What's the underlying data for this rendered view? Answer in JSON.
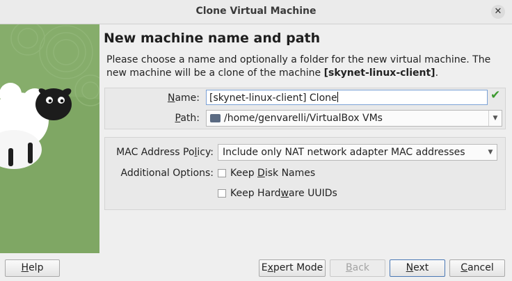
{
  "window": {
    "title": "Clone Virtual Machine",
    "close_glyph": "✕"
  },
  "page": {
    "heading": "New machine name and path",
    "description_prefix": "Please choose a name and optionally a folder for the new virtual machine. The new machine will be a clone of the machine ",
    "source_machine": "[skynet-linux-client]",
    "description_suffix": "."
  },
  "name_field": {
    "label_mnemonic": "N",
    "label_rest": "ame:",
    "value": "[skynet-linux-client] Clone",
    "valid_icon": "check-icon"
  },
  "path_field": {
    "label_mnemonic": "P",
    "label_rest": "ath:",
    "value": "/home/genvarelli/VirtualBox VMs",
    "icon": "folder-icon"
  },
  "mac_policy": {
    "label_before": "MAC Address Po",
    "label_mnemonic": "l",
    "label_after": "icy:",
    "selected": "Include only NAT network adapter MAC addresses"
  },
  "additional_options": {
    "label": "Additional Options:",
    "keep_disk_names": {
      "before": "Keep ",
      "mnemonic": "D",
      "after": "isk Names",
      "checked": false
    },
    "keep_hardware_uuids": {
      "before": "Keep Hard",
      "mnemonic": "w",
      "after": "are UUIDs",
      "checked": false
    }
  },
  "buttons": {
    "help": {
      "mnemonic": "H",
      "rest": "elp"
    },
    "expert_mode": {
      "before": "E",
      "mnemonic": "x",
      "after": "pert Mode"
    },
    "back": {
      "mnemonic": "B",
      "rest": "ack",
      "disabled": true
    },
    "next": {
      "mnemonic": "N",
      "rest": "ext"
    },
    "cancel": {
      "mnemonic": "C",
      "rest": "ancel"
    }
  },
  "colors": {
    "sidebar_green": "#7fa764",
    "accent": "#4a78b5",
    "valid_green": "#3d9a2f"
  }
}
